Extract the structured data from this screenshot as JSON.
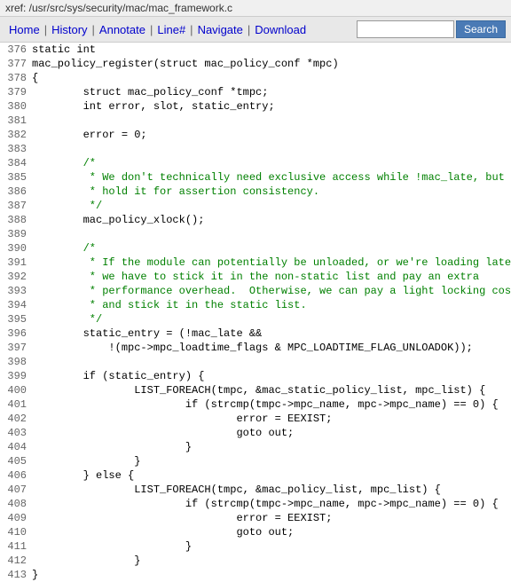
{
  "titleBar": {
    "text": "xref: /usr/src/sys/security/mac/mac_framework.c"
  },
  "nav": {
    "items": [
      {
        "label": "Home",
        "sep": true
      },
      {
        "label": "History",
        "sep": true
      },
      {
        "label": "Annotate",
        "sep": true
      },
      {
        "label": "Line#",
        "sep": true
      },
      {
        "label": "Navigate",
        "sep": true
      },
      {
        "label": "Download",
        "sep": false
      }
    ],
    "search": {
      "placeholder": "",
      "button": "Search"
    }
  },
  "lines": [
    {
      "num": "376",
      "content": "static int"
    },
    {
      "num": "377",
      "content": "mac_policy_register(struct mac_policy_conf *mpc)"
    },
    {
      "num": "378",
      "content": "{"
    },
    {
      "num": "379",
      "content": "        struct mac_policy_conf *tmpc;"
    },
    {
      "num": "380",
      "content": "        int error, slot, static_entry;"
    },
    {
      "num": "381",
      "content": ""
    },
    {
      "num": "382",
      "content": "        error = 0;"
    },
    {
      "num": "383",
      "content": ""
    },
    {
      "num": "384",
      "content": "        /*"
    },
    {
      "num": "385",
      "content": "         * We don't technically need exclusive access while !mac_late, but"
    },
    {
      "num": "386",
      "content": "         * hold it for assertion consistency."
    },
    {
      "num": "387",
      "content": "         */"
    },
    {
      "num": "388",
      "content": "        mac_policy_xlock();"
    },
    {
      "num": "389",
      "content": ""
    },
    {
      "num": "390",
      "content": "        /*"
    },
    {
      "num": "391",
      "content": "         * If the module can potentially be unloaded, or we're loading late,"
    },
    {
      "num": "392",
      "content": "         * we have to stick it in the non-static list and pay an extra"
    },
    {
      "num": "393",
      "content": "         * performance overhead.  Otherwise, we can pay a light locking cost"
    },
    {
      "num": "394",
      "content": "         * and stick it in the static list."
    },
    {
      "num": "395",
      "content": "         */"
    },
    {
      "num": "396",
      "content": "        static_entry = (!mac_late &&"
    },
    {
      "num": "397",
      "content": "            !(mpc->mpc_loadtime_flags & MPC_LOADTIME_FLAG_UNLOADOK));"
    },
    {
      "num": "398",
      "content": ""
    },
    {
      "num": "399",
      "content": "        if (static_entry) {"
    },
    {
      "num": "400",
      "content": "                LIST_FOREACH(tmpc, &mac_static_policy_list, mpc_list) {"
    },
    {
      "num": "401",
      "content": "                        if (strcmp(tmpc->mpc_name, mpc->mpc_name) == 0) {"
    },
    {
      "num": "402",
      "content": "                                error = EEXIST;"
    },
    {
      "num": "403",
      "content": "                                goto out;"
    },
    {
      "num": "404",
      "content": "                        }"
    },
    {
      "num": "405",
      "content": "                }"
    },
    {
      "num": "406",
      "content": "        } else {"
    },
    {
      "num": "407",
      "content": "                LIST_FOREACH(tmpc, &mac_policy_list, mpc_list) {"
    },
    {
      "num": "408",
      "content": "                        if (strcmp(tmpc->mpc_name, mpc->mpc_name) == 0) {"
    },
    {
      "num": "409",
      "content": "                                error = EEXIST;"
    },
    {
      "num": "410",
      "content": "                                goto out;"
    },
    {
      "num": "411",
      "content": "                        }"
    },
    {
      "num": "412",
      "content": "                }"
    },
    {
      "num": "413",
      "content": "}"
    }
  ]
}
